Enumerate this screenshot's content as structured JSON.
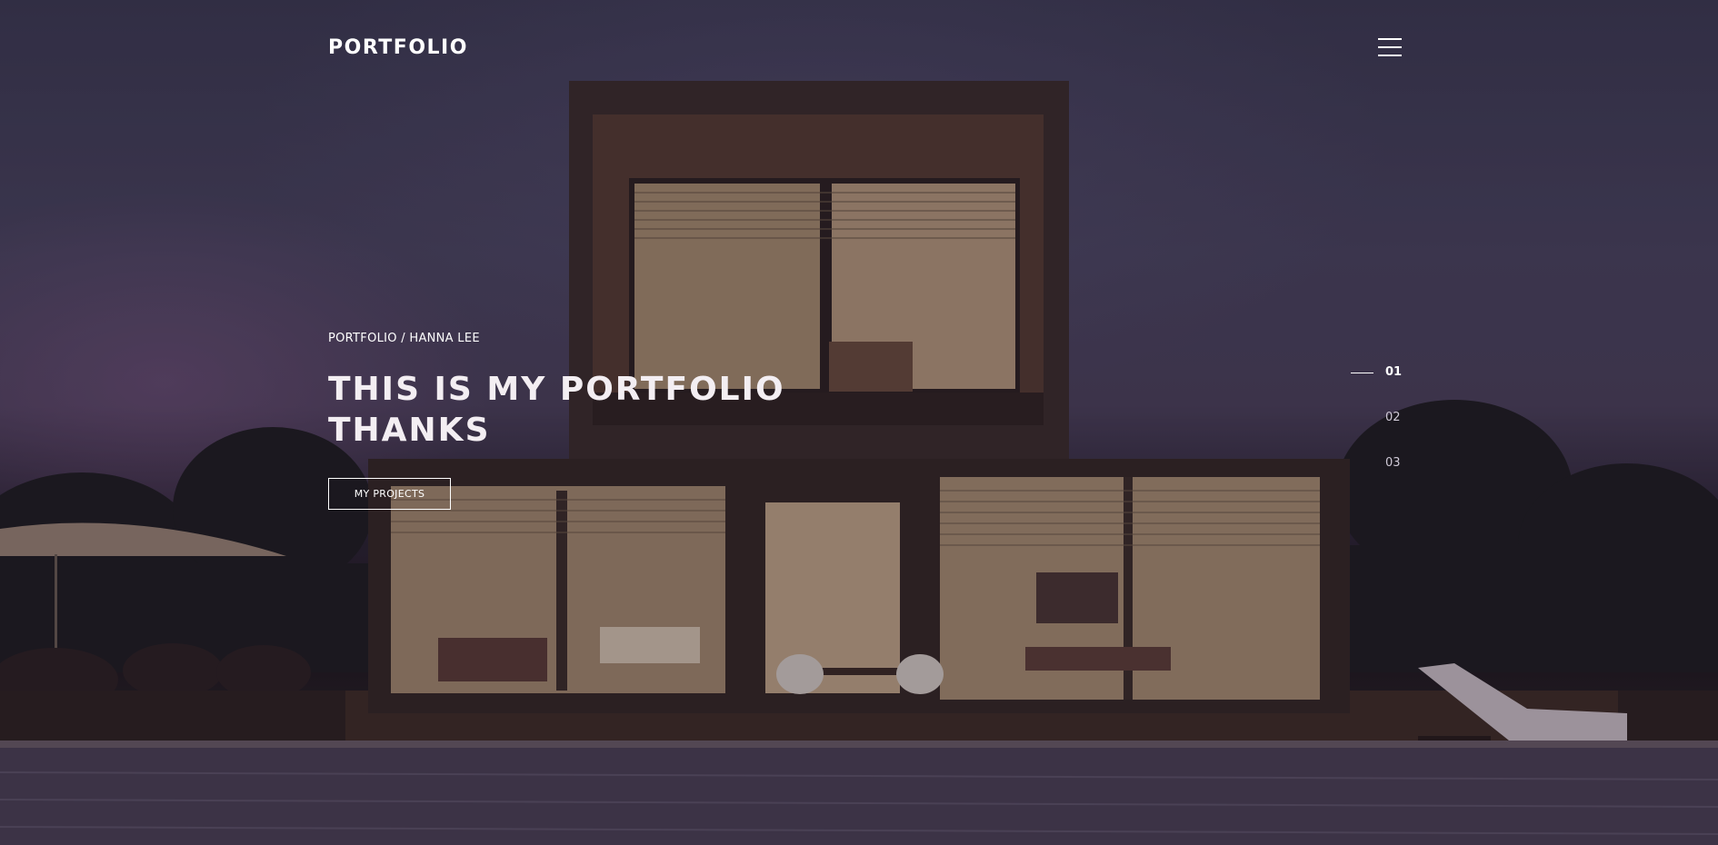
{
  "header": {
    "logo": "PORTFOLIO",
    "menu_icon": "hamburger-icon"
  },
  "hero": {
    "breadcrumb": "PORTFOLIO / HANNA LEE",
    "title_line1": "THIS IS MY PORTFOLIO",
    "title_line2": "THANKS",
    "cta_label": "MY PROJECTS"
  },
  "pager": {
    "items": [
      "01",
      "02",
      "03"
    ],
    "active_index": 0
  },
  "colors": {
    "text": "#ffffff",
    "overlay": "#2a2633"
  }
}
